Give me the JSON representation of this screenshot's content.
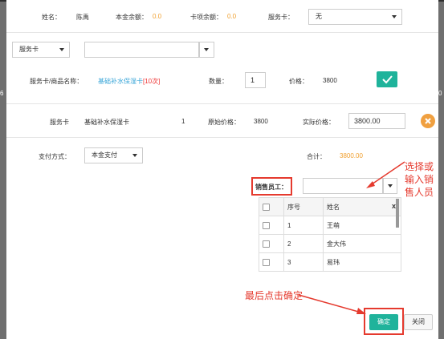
{
  "header": {
    "name_label": "姓名：",
    "name_value": "陈禹",
    "principal_label": "本金余额：",
    "principal_value": "0.0",
    "card_balance_label": "卡项余额：",
    "card_balance_value": "0.0",
    "service_card_label": "服务卡：",
    "service_card_value": "无"
  },
  "filter": {
    "type_value": "服务卡",
    "search_value": ""
  },
  "product": {
    "label": "服务卡/商品名称：",
    "name": "基础补水保湿卡",
    "count_tag": "[10次]",
    "qty_label": "数量：",
    "qty_value": "1",
    "price_label": "价格：",
    "price_value": "3800"
  },
  "line_item": {
    "type": "服务卡",
    "name": "基础补水保湿卡",
    "qty": "1",
    "orig_price_label": "原始价格：",
    "orig_price_value": "3800",
    "actual_price_label": "实际价格：",
    "actual_price_value": "3800.00"
  },
  "payment": {
    "label": "支付方式：",
    "method_value": "本金支付",
    "total_label": "合计：",
    "total_value": "3800.00"
  },
  "staff": {
    "label": "销售员工：",
    "input_value": "",
    "close_x": "x",
    "columns": [
      "序号",
      "姓名"
    ],
    "rows": [
      {
        "no": "1",
        "name": "王萌"
      },
      {
        "no": "2",
        "name": "金大伟"
      },
      {
        "no": "3",
        "name": "易玮"
      }
    ]
  },
  "annotations": {
    "select_staff": [
      "选择或",
      "输入销",
      "售人员"
    ],
    "confirm_last": "最后点击确定"
  },
  "buttons": {
    "confirm": "确定",
    "close": "关闭"
  },
  "colors": {
    "accent": "#1fb39b",
    "orange": "#f0a030",
    "annotation_red": "#e53a2e"
  }
}
